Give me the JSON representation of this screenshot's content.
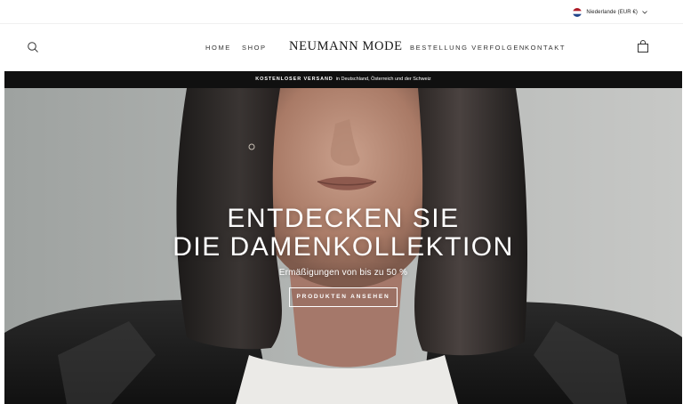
{
  "utility": {
    "country_label": "Niederlande (EUR €)",
    "flag": "netherlands-flag-icon"
  },
  "header": {
    "logo": "NEUMANN MODE",
    "nav": [
      {
        "label": "HOME"
      },
      {
        "label": "SHOP"
      },
      {
        "label": "BESTELLUNG VERFOLGEN"
      },
      {
        "label": "KONTAKT"
      }
    ],
    "search_icon": "search-icon",
    "cart_icon": "shopping-bag-icon"
  },
  "announcement": {
    "bold": "KOSTENLOSER VERSAND",
    "text": "in Deutschland, Österreich und der Schweiz"
  },
  "hero": {
    "title_line1": "ENTDECKEN SIE",
    "title_line2": "DIE DAMENKOLLEKTION",
    "subtitle": "Ermäßigungen von bis zu 50 %",
    "cta": "PRODUKTEN ANSEHEN"
  },
  "colors": {
    "announcement_bg": "#101010",
    "hero_bg": "#a6aaa8",
    "text_dark": "#151515",
    "text_light": "#ffffff"
  }
}
